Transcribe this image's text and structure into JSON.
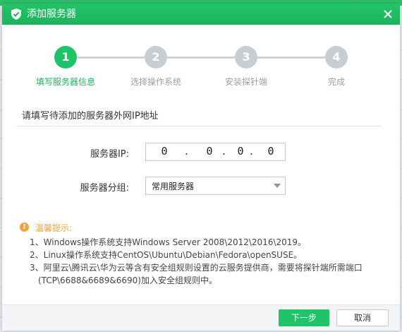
{
  "dialog": {
    "title": "添加服务器",
    "accent_color": "#1ec467",
    "title_icon": "shield-check-icon",
    "close_icon": "close-icon"
  },
  "steps": [
    {
      "number": "1",
      "label": "填写服务器信息",
      "active": true
    },
    {
      "number": "2",
      "label": "选择操作系统",
      "active": false
    },
    {
      "number": "3",
      "label": "安装探针端",
      "active": false
    },
    {
      "number": "4",
      "label": "完成",
      "active": false
    }
  ],
  "section": {
    "title": "请填写待添加的服务器外网IP地址"
  },
  "form": {
    "ip_label": "服务器IP:",
    "ip": {
      "oct1": "0",
      "oct2": "0",
      "oct3": "0",
      "oct4": "0"
    },
    "group_label": "服务器分组:",
    "group_value": "常用服务器"
  },
  "tips": {
    "title": "温馨提示:",
    "lines": [
      "1、Windows操作系统支持Windows Server 2008\\2012\\2016\\2019。",
      "2、Linux操作系统支持CentOS\\Ubuntu\\Debian\\Fedora\\openSUSE。",
      "3、阿里云\\腾讯云\\华为云等含有安全组规则设置的云服务提供商，需要将探针端所需端口",
      "(TCP\\6688&6689&6690)加入安全组规则中。"
    ],
    "icon": "warning-icon"
  },
  "footer": {
    "next_label": "下一步",
    "cancel_label": "取消"
  }
}
